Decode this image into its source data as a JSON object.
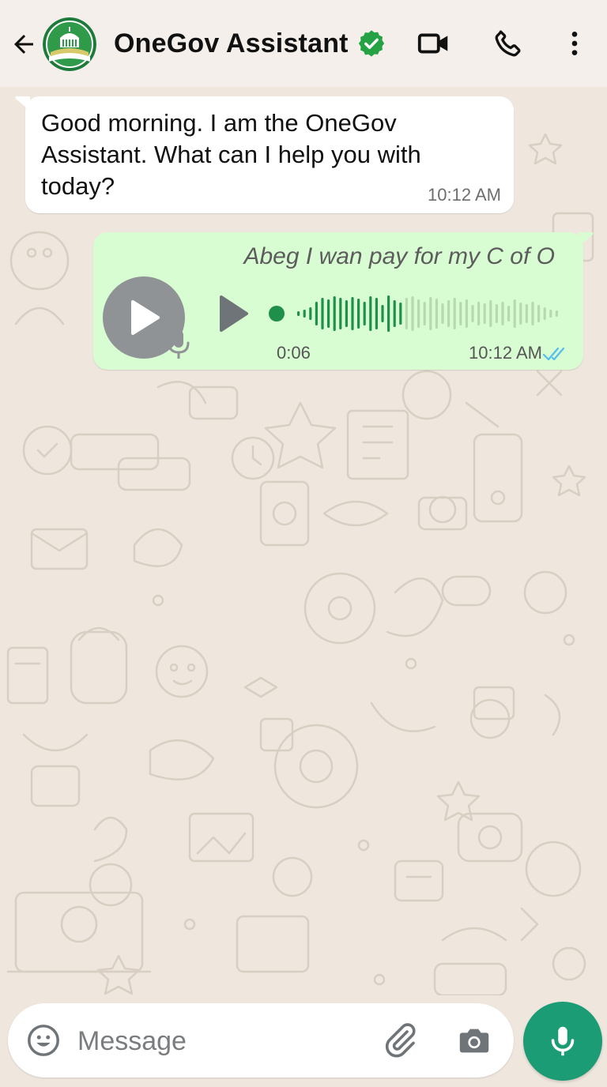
{
  "header": {
    "title": "OneGov Assistant",
    "back_icon": "arrow-left-icon",
    "verified_icon": "verified-badge-icon",
    "actions": [
      "video-call-icon",
      "phone-icon",
      "more-vertical-icon"
    ]
  },
  "messages": {
    "incoming": {
      "text": "Good morning. I am the OneGov Assistant. What can I help you with today?",
      "time": "10:12 AM"
    },
    "outgoing_voice": {
      "caption": "Abeg I wan pay for my C of O",
      "duration": "0:06",
      "time": "10:12 AM",
      "played_fraction": 0.42,
      "status_icon": "double-check-icon"
    }
  },
  "composer": {
    "placeholder": "Message",
    "emoji_icon": "emoji-icon",
    "attach_icon": "paperclip-icon",
    "camera_icon": "camera-icon",
    "mic_icon": "mic-icon"
  },
  "colors": {
    "accent": "#1b9c75",
    "outgoing_bubble": "#d9fdd3",
    "incoming_bubble": "#ffffff",
    "background": "#efe7de",
    "verified": "#25a244",
    "waveform_played": "#1f8f4a",
    "waveform_unplayed": "#b7d8b0",
    "read_ticks": "#53bdeb"
  }
}
